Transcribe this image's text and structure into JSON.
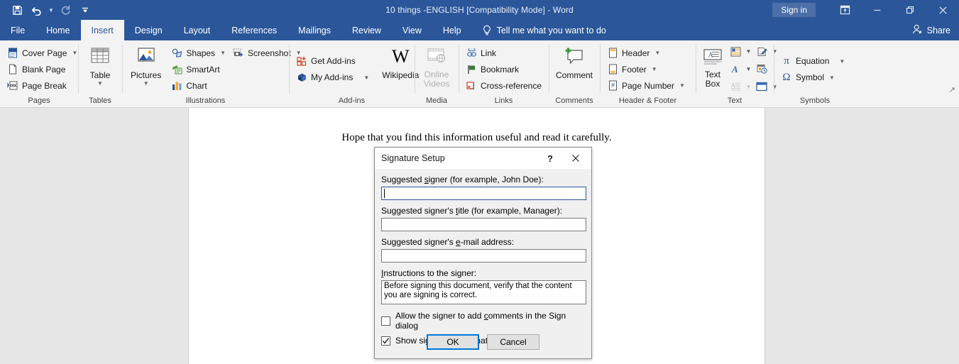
{
  "titlebar": {
    "document_title": "10 things -ENGLISH [Compatibility Mode]  -  Word",
    "signin_label": "Sign in",
    "qat": [
      {
        "name": "save-icon",
        "label": "Save"
      },
      {
        "name": "undo-icon",
        "label": "Undo"
      },
      {
        "name": "redo-icon",
        "label": "Redo"
      },
      {
        "name": "customize-qat-icon",
        "label": "Customize Quick Access Toolbar"
      }
    ],
    "window_controls": [
      {
        "name": "ribbon-display-options",
        "glyph": "⬒"
      },
      {
        "name": "minimize",
        "glyph": "—"
      },
      {
        "name": "restore",
        "glyph": "❐"
      },
      {
        "name": "close",
        "glyph": "✕"
      }
    ]
  },
  "tabs": [
    {
      "id": "file",
      "label": "File",
      "active": false
    },
    {
      "id": "home",
      "label": "Home",
      "active": false
    },
    {
      "id": "insert",
      "label": "Insert",
      "active": true
    },
    {
      "id": "design",
      "label": "Design",
      "active": false
    },
    {
      "id": "layout",
      "label": "Layout",
      "active": false
    },
    {
      "id": "references",
      "label": "References",
      "active": false
    },
    {
      "id": "mailings",
      "label": "Mailings",
      "active": false
    },
    {
      "id": "review",
      "label": "Review",
      "active": false
    },
    {
      "id": "view",
      "label": "View",
      "active": false
    },
    {
      "id": "help",
      "label": "Help",
      "active": false
    }
  ],
  "tellme": {
    "label": "Tell me what you want to do",
    "icon": "lightbulb-icon"
  },
  "share": {
    "label": "Share",
    "icon": "share-person-icon"
  },
  "ribbon": {
    "collapse_label": "↗",
    "groups": [
      {
        "id": "pages",
        "label": "Pages",
        "items": [
          {
            "label": "Cover Page",
            "icon": "cover-page-icon",
            "dropdown": true
          },
          {
            "label": "Blank Page",
            "icon": "blank-page-icon",
            "dropdown": false
          },
          {
            "label": "Page Break",
            "icon": "page-break-icon",
            "dropdown": false
          }
        ]
      },
      {
        "id": "tables",
        "label": "Tables",
        "items": [
          {
            "label": "Table",
            "icon": "table-icon",
            "dropdown": true,
            "big": true
          }
        ]
      },
      {
        "id": "illustrations",
        "label": "Illustrations",
        "items": [
          {
            "label": "Pictures",
            "icon": "pictures-icon",
            "dropdown": true,
            "big": true
          },
          {
            "label": "Shapes",
            "icon": "shapes-icon",
            "dropdown": true
          },
          {
            "label": "SmartArt",
            "icon": "smartart-icon",
            "dropdown": false
          },
          {
            "label": "Chart",
            "icon": "chart-icon",
            "dropdown": false
          },
          {
            "label": "Screenshot",
            "icon": "screenshot-icon",
            "dropdown": true
          }
        ]
      },
      {
        "id": "addins",
        "label": "Add-ins",
        "items": [
          {
            "label": "Get Add-ins",
            "icon": "get-addins-icon",
            "dropdown": false
          },
          {
            "label": "My Add-ins",
            "icon": "my-addins-icon",
            "dropdown": true
          },
          {
            "label": "Wikipedia",
            "icon": "wikipedia-icon",
            "dropdown": false,
            "big": true
          }
        ]
      },
      {
        "id": "media",
        "label": "Media",
        "items": [
          {
            "label": "Online Videos",
            "icon": "online-videos-icon",
            "dropdown": false,
            "big": true,
            "disabled": true
          }
        ]
      },
      {
        "id": "links",
        "label": "Links",
        "items": [
          {
            "label": "Link",
            "icon": "link-icon",
            "dropdown": false
          },
          {
            "label": "Bookmark",
            "icon": "bookmark-icon",
            "dropdown": false
          },
          {
            "label": "Cross-reference",
            "icon": "cross-reference-icon",
            "dropdown": false
          }
        ]
      },
      {
        "id": "comments",
        "label": "Comments",
        "items": [
          {
            "label": "Comment",
            "icon": "comment-icon",
            "dropdown": false,
            "big": true
          }
        ]
      },
      {
        "id": "header-footer",
        "label": "Header & Footer",
        "items": [
          {
            "label": "Header",
            "icon": "header-icon",
            "dropdown": true
          },
          {
            "label": "Footer",
            "icon": "footer-icon",
            "dropdown": true
          },
          {
            "label": "Page Number",
            "icon": "page-number-icon",
            "dropdown": true
          }
        ]
      },
      {
        "id": "text",
        "label": "Text",
        "items": [
          {
            "label": "Text Box",
            "icon": "text-box-icon",
            "dropdown": true,
            "big": true
          },
          {
            "label": "Quick Parts",
            "icon": "quick-parts-icon",
            "dropdown": true
          },
          {
            "label": "WordArt",
            "icon": "wordart-icon",
            "dropdown": true
          },
          {
            "label": "Drop Cap",
            "icon": "drop-cap-icon",
            "dropdown": true,
            "disabled": true
          },
          {
            "label": "Signature Line",
            "icon": "signature-line-icon",
            "dropdown": true
          },
          {
            "label": "Date & Time",
            "icon": "date-time-icon",
            "dropdown": false
          },
          {
            "label": "Object",
            "icon": "object-icon",
            "dropdown": true
          }
        ]
      },
      {
        "id": "symbols",
        "label": "Symbols",
        "items": [
          {
            "label": "Equation",
            "icon": "equation-icon",
            "dropdown": true
          },
          {
            "label": "Symbol",
            "icon": "symbol-icon",
            "dropdown": true
          }
        ]
      }
    ]
  },
  "document": {
    "body_text": "Hope that you find this information useful and read it carefully."
  },
  "dialog": {
    "title": "Signature Setup",
    "help_glyph": "?",
    "close_glyph": "✕",
    "fields": [
      {
        "id": "suggested-signer",
        "label_pre": "Suggested ",
        "label_key": "s",
        "label_post": "igner (for example, John Doe):",
        "value": "",
        "focused": true
      },
      {
        "id": "suggested-signer-title",
        "label_pre": "Suggested signer's ",
        "label_key": "t",
        "label_post": "itle (for example, Manager):",
        "value": "",
        "focused": false
      },
      {
        "id": "suggested-signer-email",
        "label_pre": "Suggested signer's ",
        "label_key": "e",
        "label_post": "-mail address:",
        "value": "",
        "focused": false
      }
    ],
    "instructions": {
      "label_pre": "",
      "label_key": "I",
      "label_post": "nstructions to the signer:",
      "value": "Before signing this document, verify that the content you are signing is correct."
    },
    "checkboxes": [
      {
        "id": "allow-comments",
        "label_pre": "Allow the signer to add ",
        "label_key": "c",
        "label_post": "omments in the Sign dialog",
        "checked": false
      },
      {
        "id": "show-sign-date",
        "label_pre": "Show sign ",
        "label_key": "d",
        "label_post": "ate in signature line",
        "checked": true
      }
    ],
    "ok_label": "OK",
    "cancel_label": "Cancel"
  },
  "colors": {
    "word_blue": "#2b579a",
    "ribbon_bg": "#f3f3f3",
    "accent_focus": "#0078d7"
  }
}
